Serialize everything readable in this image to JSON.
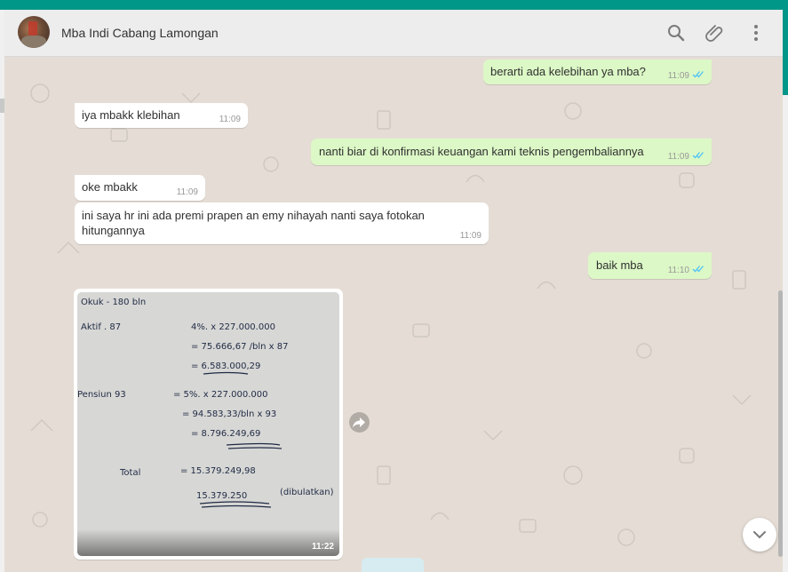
{
  "colors": {
    "accent": "#009688",
    "outgoing_bubble": "#dcf8c6",
    "incoming_bubble": "#ffffff",
    "chat_bg": "#e5ddd5",
    "read_ticks": "#4fc3f7"
  },
  "header": {
    "contact_name": "Mba Indi Cabang Lamongan",
    "icons": [
      "search-icon",
      "paperclip-icon",
      "more-vertical-icon"
    ]
  },
  "messages": [
    {
      "direction": "out",
      "text": "berarti ada kelebihan ya mba?",
      "time": "11:09",
      "status": "read"
    },
    {
      "direction": "in",
      "text": "iya mbakk klebihan",
      "time": "11:09"
    },
    {
      "direction": "out",
      "text": "nanti biar di konfirmasi keuangan kami teknis pengembaliannya",
      "time": "11:09",
      "status": "read"
    },
    {
      "direction": "in",
      "text": "oke mbakk",
      "time": "11:09"
    },
    {
      "direction": "in",
      "text": "ini saya hr ini ada premi prapen an emy nihayah nanti saya fotokan hitungannya",
      "time": "11:09"
    },
    {
      "direction": "out",
      "text": "baik mba",
      "time": "11:10",
      "status": "read"
    },
    {
      "direction": "in",
      "type": "image",
      "time": "11:22"
    }
  ],
  "photo_note": {
    "line1": "Okuk - 180 bln",
    "line2a": "Aktif . 87",
    "line2b": "4%. x 227.000.000",
    "line3": "= 75.666,67 /bln x 87",
    "line4": "= 6.583.000,29",
    "line5a": "Pensiun 93",
    "line5b": "= 5%. x 227.000.000",
    "line6": "= 94.583,33/bln x 93",
    "line7": "= 8.796.249,69",
    "line8a": "Total",
    "line8b": "= 15.379.249,98",
    "line9": "15.379.250",
    "line9b": "(dibulatkan)"
  }
}
